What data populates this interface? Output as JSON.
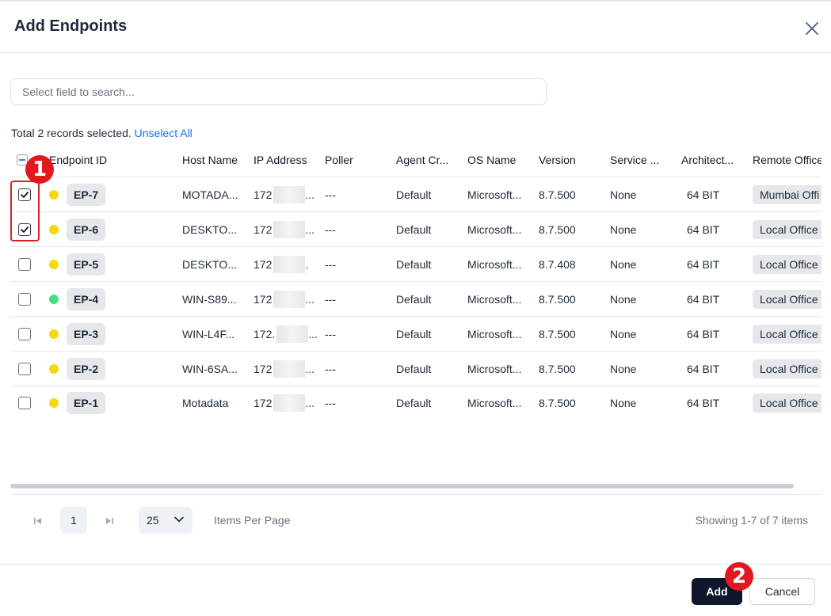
{
  "dialog": {
    "title": "Add Endpoints",
    "close_icon": "close-icon"
  },
  "search": {
    "placeholder": "Select field to search..."
  },
  "selection": {
    "summary_text": "Total 2 records selected.",
    "unselect_label": "Unselect All"
  },
  "table": {
    "columns": [
      "Endpoint ID",
      "Host Name",
      "IP Address",
      "Poller",
      "Agent Cr...",
      "OS Name",
      "Version",
      "Service ...",
      "Architect...",
      "Remote Office"
    ],
    "rows": [
      {
        "checked": true,
        "status_color": "#f5d90a",
        "endpoint_id": "EP-7",
        "host_name": "MOTADA...",
        "ip_prefix": "172",
        "ip_suffix": "...",
        "poller": "---",
        "agent": "Default",
        "os_name": "Microsoft...",
        "version": "8.7.500",
        "service": "None",
        "arch": "64 BIT",
        "office": "Mumbai Offi"
      },
      {
        "checked": true,
        "status_color": "#f5d90a",
        "endpoint_id": "EP-6",
        "host_name": "DESKTO...",
        "ip_prefix": "172",
        "ip_suffix": "...",
        "poller": "---",
        "agent": "Default",
        "os_name": "Microsoft...",
        "version": "8.7.500",
        "service": "None",
        "arch": "64 BIT",
        "office": "Local Office"
      },
      {
        "checked": false,
        "status_color": "#f5d90a",
        "endpoint_id": "EP-5",
        "host_name": "DESKTO...",
        "ip_prefix": "172",
        "ip_suffix": ".",
        "poller": "---",
        "agent": "Default",
        "os_name": "Microsoft...",
        "version": "8.7.408",
        "service": "None",
        "arch": "64 BIT",
        "office": "Local Office"
      },
      {
        "checked": false,
        "status_color": "#4ade80",
        "endpoint_id": "EP-4",
        "host_name": "WIN-S89...",
        "ip_prefix": "172",
        "ip_suffix": "...",
        "poller": "---",
        "agent": "Default",
        "os_name": "Microsoft...",
        "version": "8.7.500",
        "service": "None",
        "arch": "64 BIT",
        "office": "Local Office"
      },
      {
        "checked": false,
        "status_color": "#f5d90a",
        "endpoint_id": "EP-3",
        "host_name": "WIN-L4F...",
        "ip_prefix": "172.",
        "ip_suffix": "...",
        "poller": "---",
        "agent": "Default",
        "os_name": "Microsoft...",
        "version": "8.7.500",
        "service": "None",
        "arch": "64 BIT",
        "office": "Local Office"
      },
      {
        "checked": false,
        "status_color": "#f5d90a",
        "endpoint_id": "EP-2",
        "host_name": "WIN-6SA...",
        "ip_prefix": "172",
        "ip_suffix": "...",
        "poller": "---",
        "agent": "Default",
        "os_name": "Microsoft...",
        "version": "8.7.500",
        "service": "None",
        "arch": "64 BIT",
        "office": "Local Office"
      },
      {
        "checked": false,
        "status_color": "#f5d90a",
        "endpoint_id": "EP-1",
        "host_name": "Motadata",
        "ip_prefix": "172",
        "ip_suffix": "...",
        "poller": "---",
        "agent": "Default",
        "os_name": "Microsoft...",
        "version": "8.7.500",
        "service": "None",
        "arch": "64 BIT",
        "office": "Local Office"
      }
    ]
  },
  "pagination": {
    "current_page": "1",
    "page_size": "25",
    "items_per_page_label": "Items Per Page",
    "showing_text": "Showing 1-7 of 7 items"
  },
  "footer": {
    "add_label": "Add",
    "cancel_label": "Cancel"
  },
  "annotations": {
    "step1": "1",
    "step2": "2",
    "highlight_color": "#e3181f"
  }
}
